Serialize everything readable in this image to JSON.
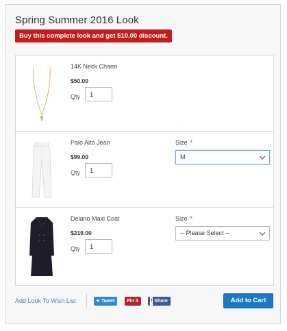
{
  "look": {
    "title": "Spring Summer 2016 Look",
    "promo": "Buy this complete look and get $10.00 discount."
  },
  "items": [
    {
      "name": "14K Neck Charm",
      "price": "$50.00",
      "qty_label": "Qty",
      "qty": "1"
    },
    {
      "name": "Palo Alto Jean",
      "price": "$99.00",
      "qty_label": "Qty",
      "qty": "1",
      "size_label": "Size",
      "required": "*",
      "size_value": "M"
    },
    {
      "name": "Delano Maxi Coat",
      "price": "$219.00",
      "qty_label": "Qty",
      "qty": "1",
      "size_label": "Size",
      "required": "*",
      "size_value": "-- Please Select --"
    }
  ],
  "footer": {
    "wishlist_label": "Add Look To Wish List",
    "tweet_label": "Tweet",
    "pin_label": "Pin it",
    "share_label": "Share",
    "cart_label": "Add to Cart"
  },
  "colors": {
    "promo_bg": "#c41c1c",
    "primary_button": "#1979c3",
    "twitter": "#2c8bd0",
    "pinterest": "#b8202a",
    "facebook": "#3c5a96"
  },
  "icons": {
    "tweet": "twitter-bird-icon",
    "pin": "pinterest-icon",
    "share": "facebook-icon",
    "select": "chevron-down-icon"
  }
}
